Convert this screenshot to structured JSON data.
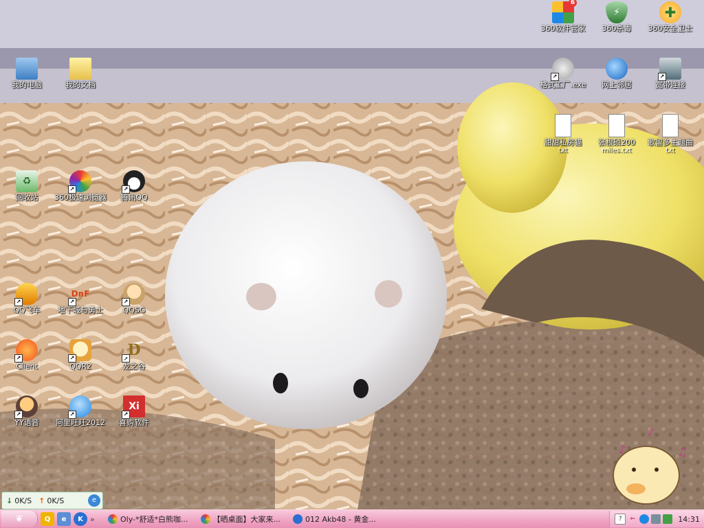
{
  "desktop_icons": [
    {
      "id": "my-computer",
      "label": "我的电脑",
      "icon": "computer-icon",
      "shortcut": false
    },
    {
      "id": "my-documents",
      "label": "我的文档",
      "icon": "folder-documents-icon",
      "shortcut": false
    },
    {
      "id": "recycle-bin",
      "label": "回收站",
      "icon": "recycle-bin-icon",
      "shortcut": false
    },
    {
      "id": "browser-360",
      "label": "360极速浏览器",
      "icon": "browser-360-icon",
      "shortcut": true
    },
    {
      "id": "tencent-qq",
      "label": "腾讯QQ",
      "icon": "qq-penguin-icon",
      "shortcut": true
    },
    {
      "id": "qq-speed",
      "label": "QQ飞车",
      "icon": "qq-speed-icon",
      "shortcut": true
    },
    {
      "id": "dnf",
      "label": "地下城与勇士",
      "icon": "dnf-icon",
      "shortcut": true
    },
    {
      "id": "qqsg",
      "label": "QQSG",
      "icon": "qqsg-icon",
      "shortcut": true
    },
    {
      "id": "client",
      "label": "Client",
      "icon": "client-icon",
      "shortcut": true
    },
    {
      "id": "qqr2",
      "label": "QQR2",
      "icon": "qqr2-icon",
      "shortcut": true
    },
    {
      "id": "dragon-valley",
      "label": "龙之谷",
      "icon": "dragon-valley-icon",
      "shortcut": true
    },
    {
      "id": "yy-voice",
      "label": "YY语音",
      "icon": "yy-voice-icon",
      "shortcut": true
    },
    {
      "id": "aliwangwang",
      "label": "阿里旺旺2012",
      "icon": "aliwangwang-icon",
      "shortcut": true
    },
    {
      "id": "xigou",
      "label": "喜购软件",
      "icon": "xigou-icon",
      "shortcut": true
    },
    {
      "id": "360-manager",
      "label": "360软件管家",
      "icon": "software-manager-icon",
      "shortcut": false,
      "badge": "6"
    },
    {
      "id": "360-antivirus",
      "label": "360杀毒",
      "icon": "antivirus-shield-icon",
      "shortcut": false
    },
    {
      "id": "360-safe",
      "label": "360安全卫士",
      "icon": "safe-guard-icon",
      "shortcut": false
    },
    {
      "id": "format-factory",
      "label": "格式工厂.exe",
      "icon": "format-factory-icon",
      "shortcut": true
    },
    {
      "id": "network",
      "label": "网上邻居",
      "icon": "network-places-icon",
      "shortcut": false
    },
    {
      "id": "broadband",
      "label": "宽带连接",
      "icon": "broadband-icon",
      "shortcut": true
    },
    {
      "id": "txt-1",
      "label": "甜甜私房猫",
      "sublabel": "txt",
      "icon": "text-file-icon",
      "shortcut": false
    },
    {
      "id": "txt-2",
      "label": "张根硕200",
      "sublabel": "miles.txt",
      "icon": "text-file-icon",
      "shortcut": false
    },
    {
      "id": "txt-3",
      "label": "歌留多主题曲",
      "sublabel": "txt",
      "icon": "text-file-icon",
      "shortcut": false
    }
  ],
  "speed_widget": {
    "down_label": "0K/S",
    "up_label": "0K/S",
    "down_arrow": "↓",
    "up_arrow": "↑"
  },
  "taskbar": {
    "tasks": [
      {
        "label": "Oly-*舒适*白熊咖...",
        "icon_color": "#e25b9f"
      },
      {
        "label": "【晒桌面】大家来...",
        "icon_color": "#3d8ad8"
      },
      {
        "label": "012 Akb48 - 黄金...",
        "icon_color": "#2c6fc9"
      }
    ],
    "quicklaunch_more": "»",
    "clock": "14:31"
  },
  "colors": {
    "taskbar_pink": "#efa3c1",
    "yellow_toy": "#f1e36a"
  }
}
